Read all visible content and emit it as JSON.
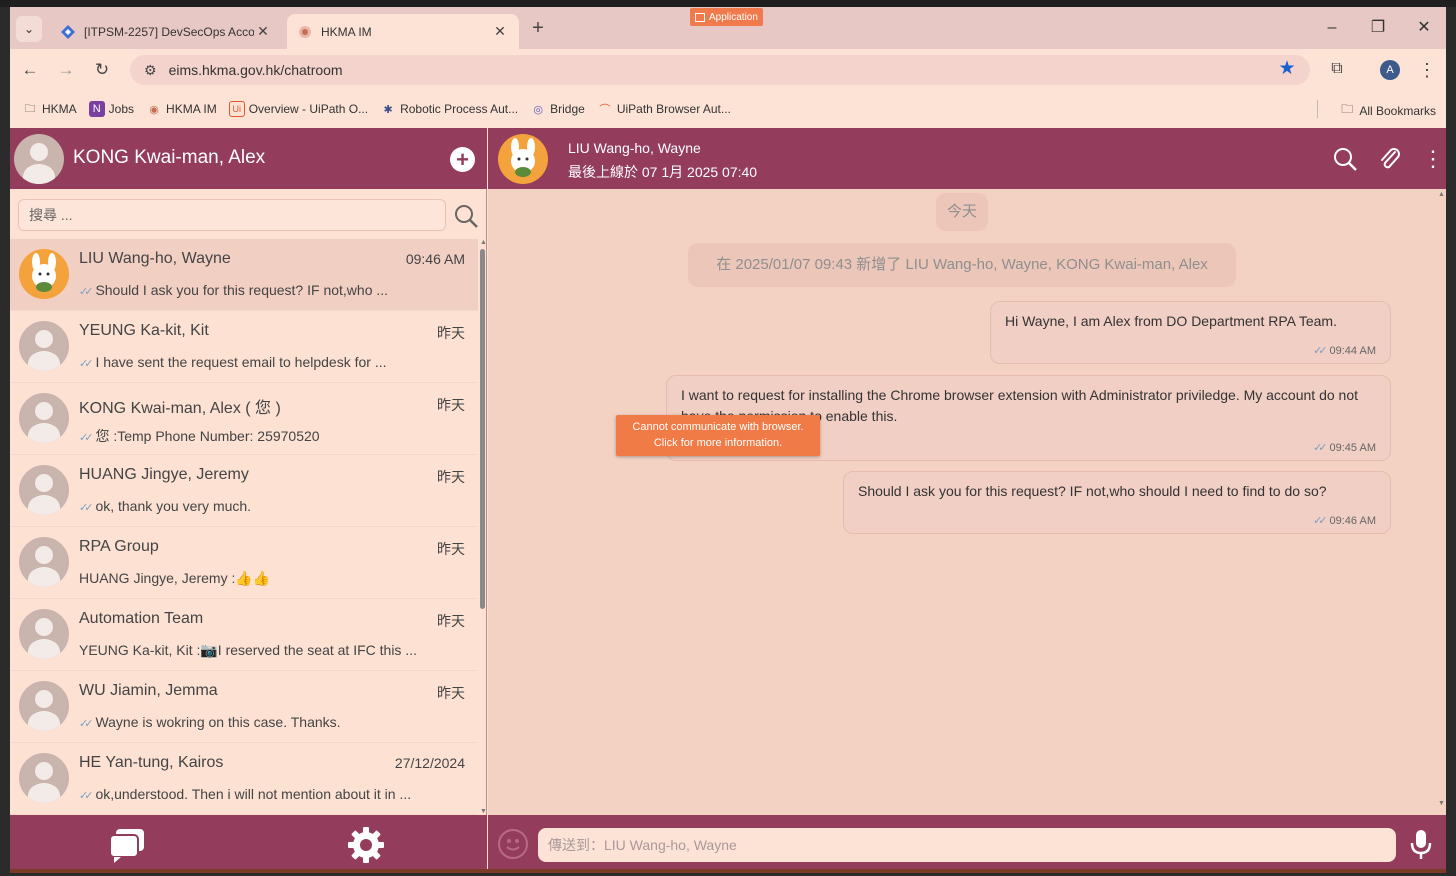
{
  "browser": {
    "tabs": [
      {
        "title": "[ITPSM-2257] DevSecOps Acco",
        "icon": "jira-diamond-icon"
      },
      {
        "title": "HKMA IM",
        "icon": "hkma-im-icon"
      }
    ],
    "app_badge": "Application",
    "url": "eims.hkma.gov.hk/chatroom",
    "profile_initial": "A",
    "bookmarks": [
      "HKMA",
      "Jobs",
      "HKMA IM",
      "Overview - UiPath O...",
      "Robotic Process Aut...",
      "Bridge",
      "UiPath Browser Aut..."
    ],
    "all_bookmarks": "All Bookmarks"
  },
  "sidebar": {
    "me_name": "KONG Kwai-man, Alex",
    "search_placeholder": "搜尋 ...",
    "chats": [
      {
        "name": "LIU Wang-ho, Wayne",
        "time": "09:46 AM",
        "message": "Should I ask you for this request? IF not,who ...",
        "ticks": true,
        "avatar": "rabbit",
        "active": true
      },
      {
        "name": "YEUNG Ka-kit, Kit",
        "time": "昨天",
        "message": "I have sent the request email to helpdesk for ...",
        "ticks": true,
        "avatar": "default"
      },
      {
        "name": "KONG Kwai-man, Alex ( 您 )",
        "time": "昨天",
        "message": "您 :Temp Phone Number: 25970520",
        "ticks": true,
        "avatar": "default"
      },
      {
        "name": "HUANG Jingye, Jeremy",
        "time": "昨天",
        "message": "ok, thank you very much.",
        "ticks": true,
        "avatar": "default"
      },
      {
        "name": "RPA Group",
        "time": "昨天",
        "message": "HUANG Jingye, Jeremy :👍👍",
        "ticks": false,
        "avatar": "default"
      },
      {
        "name": "Automation Team",
        "time": "昨天",
        "message": "YEUNG Ka-kit, Kit :📷I reserved the seat at IFC this ...",
        "ticks": false,
        "avatar": "default"
      },
      {
        "name": "WU Jiamin, Jemma",
        "time": "昨天",
        "message": "Wayne is wokring on this case. Thanks.",
        "ticks": true,
        "avatar": "default"
      },
      {
        "name": "HE Yan-tung, Kairos",
        "time": "27/12/2024",
        "message": "ok,understood. Then i will not mention about it in ...",
        "ticks": true,
        "avatar": "default"
      }
    ]
  },
  "conversation": {
    "name": "LIU Wang-ho, Wayne",
    "status": "最後上線於 07 1月 2025 07:40",
    "date_pill": "今天",
    "system_notice": "在 2025/01/07 09:43 新增了 LIU Wang-ho, Wayne, KONG Kwai-man, Alex",
    "messages": [
      {
        "text": "Hi Wayne, I am Alex from DO Department RPA Team.",
        "time": "09:44 AM"
      },
      {
        "text": "I want to request for installing the Chrome browser extension with Administrator priviledge. My account do not have the permission to enable this.",
        "time": "09:45 AM"
      },
      {
        "text": "Should I ask you for this request? IF not,who should I need to find to do so?",
        "time": "09:46 AM"
      }
    ],
    "input_placeholder": "傳送到：LIU Wang-ho, Wayne"
  },
  "toast": {
    "line1": "Cannot communicate with browser.",
    "line2": "Click for more information."
  },
  "colors": {
    "header": "#943c5c",
    "panel": "#fde1d3",
    "chat_bg": "#f3d2c4",
    "toast": "#f07b46"
  }
}
